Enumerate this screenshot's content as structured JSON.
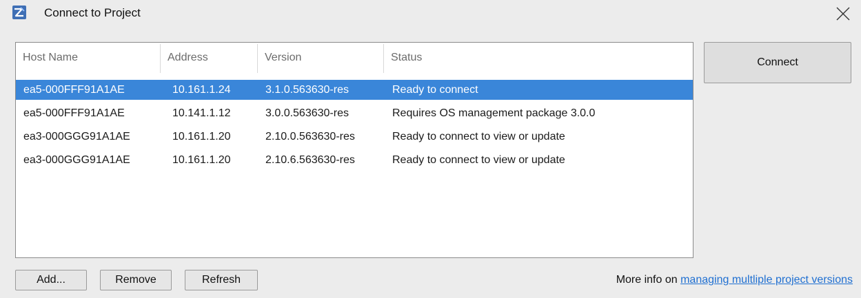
{
  "window": {
    "title": "Connect to Project",
    "app_icon": "app-logo-icon",
    "close_icon": "close-icon"
  },
  "table": {
    "columns": [
      "Host Name",
      "Address",
      "Version",
      "Status"
    ],
    "rows": [
      {
        "host": "ea5-000FFF91A1AE",
        "address": "10.161.1.24",
        "version": "3.1.0.563630-res",
        "status": "Ready to connect",
        "selected": true
      },
      {
        "host": "ea5-000FFF91A1AE",
        "address": "10.141.1.12",
        "version": "3.0.0.563630-res",
        "status": "Requires OS management package 3.0.0",
        "selected": false
      },
      {
        "host": "ea3-000GGG91A1AE",
        "address": "10.161.1.20",
        "version": "2.10.0.563630-res",
        "status": "Ready to connect to view or update",
        "selected": false
      },
      {
        "host": "ea3-000GGG91A1AE",
        "address": "10.161.1.20",
        "version": "2.10.6.563630-res",
        "status": "Ready to connect to view or update",
        "selected": false
      }
    ],
    "selected_color": "#3a86d9"
  },
  "buttons": {
    "connect": "Connect",
    "add": "Add...",
    "remove": "Remove",
    "refresh": "Refresh"
  },
  "footer": {
    "more_info_prefix": "More info on ",
    "more_info_link": "managing multliple project versions"
  },
  "colors": {
    "link": "#1f6fd1",
    "background": "#ececec"
  }
}
